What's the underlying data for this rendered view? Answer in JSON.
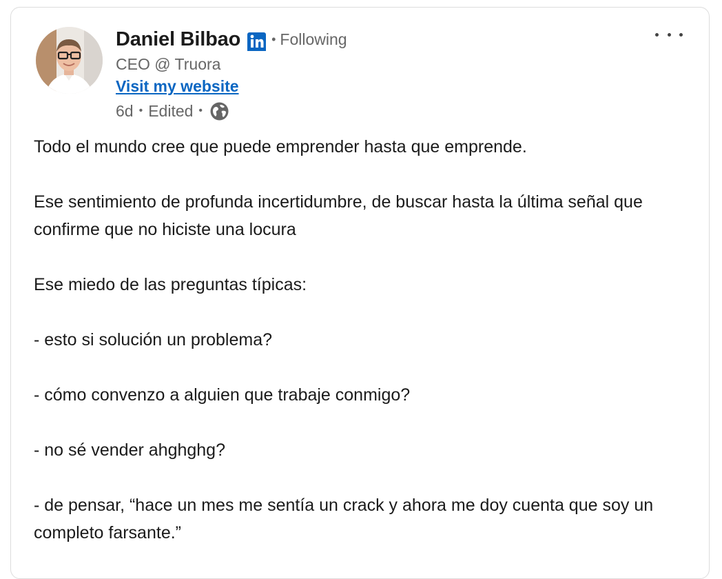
{
  "post": {
    "author": {
      "name": "Daniel Bilbao",
      "connection_status": "Following",
      "headline": "CEO @ Truora",
      "link_label": "Visit my website"
    },
    "meta": {
      "age": "6d",
      "edited": "Edited",
      "visibility_icon": "globe-icon"
    },
    "badge_icon": "linkedin-icon",
    "menu_icon": "more-horizontal-icon",
    "paragraphs": [
      "Todo el mundo cree que puede emprender hasta que emprende.",
      "Ese sentimiento de profunda incertidumbre, de buscar hasta la última señal que confirme que no hiciste una locura",
      "Ese miedo de las preguntas típicas:",
      "- esto si solución un problema?",
      "- cómo convenzo a alguien que trabaje conmigo?",
      "- no sé vender ahghghg?",
      "- de pensar, “hace un mes me sentía un crack y ahora me doy cuenta que soy un completo farsante.”"
    ]
  },
  "colors": {
    "link": "#0a66c2",
    "linkedin_blue": "#0a66c2",
    "muted_text": "#666666",
    "body_text": "#1b1b1b"
  }
}
